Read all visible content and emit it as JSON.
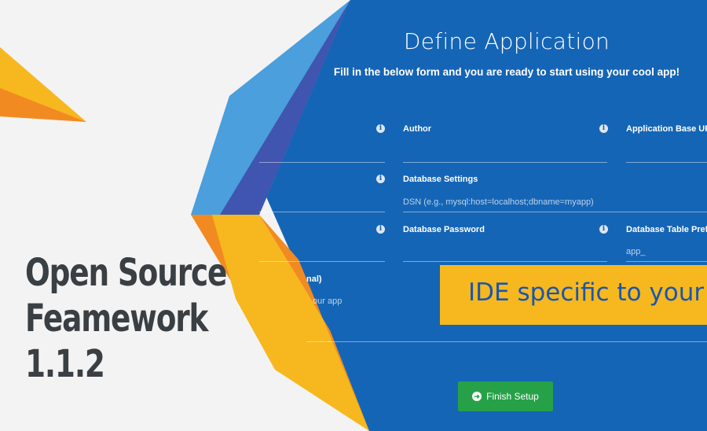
{
  "form": {
    "title": "Define Application",
    "subtitle": "Fill in the below form and you are ready to start using your cool app!",
    "fields": {
      "author": {
        "label": "Author",
        "value": ""
      },
      "base_url": {
        "label": "Application Base URL",
        "value": ""
      },
      "database_settings": {
        "label": "Database Settings",
        "placeholder": "DSN (e.g., mysql:host=localhost;dbname=myapp)"
      },
      "database_password": {
        "label": "Database Password",
        "value": ""
      },
      "table_prefix": {
        "label": "Database Table Prefix",
        "placeholder": "app_"
      },
      "description_fragment_label": "nal)",
      "description_fragment_text": "our app"
    },
    "finish_label": "Finish Setup"
  },
  "banner": {
    "text": "IDE specific to your"
  },
  "headline": {
    "line1": "Open Source",
    "line2": "Feamework",
    "line3": "1.1.2"
  },
  "colors": {
    "panel_blue": "#1565b6",
    "banner_yellow": "#f6b81e",
    "button_green": "#26a148",
    "accent_orange": "#f28a22"
  }
}
